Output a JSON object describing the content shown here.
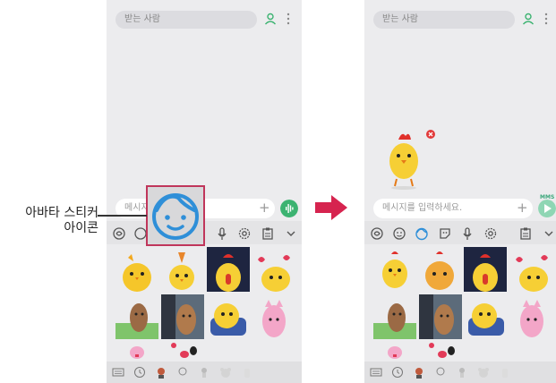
{
  "left_screen": {
    "recipient_placeholder": "받는 사람",
    "message_placeholder": "메시지"
  },
  "right_screen": {
    "recipient_placeholder": "받는 사람",
    "message_placeholder": "메시지를 입력하세요.",
    "mms_label": "MMS"
  },
  "callout": {
    "line1": "아바타 스티커",
    "line2": "아이콘"
  },
  "colors": {
    "accent_green": "#3cb371",
    "send_light": "#8fd6b4",
    "callout_border": "#c0365b",
    "arrow": "#d6244f",
    "avatar_blue": "#2f8fd8"
  },
  "icons": {
    "toolbar": [
      "bixby-sticker-icon",
      "emoji-icon",
      "avatar-sticker-icon",
      "sticker-icon",
      "voice-icon",
      "settings-icon",
      "clipboard-icon",
      "chevron-down-icon"
    ],
    "bottom": [
      "keyboard-icon",
      "recent-icon",
      "avatar-icon",
      "avatar-outline-icon",
      "character-icon",
      "bear-icon",
      "cup-icon"
    ]
  }
}
